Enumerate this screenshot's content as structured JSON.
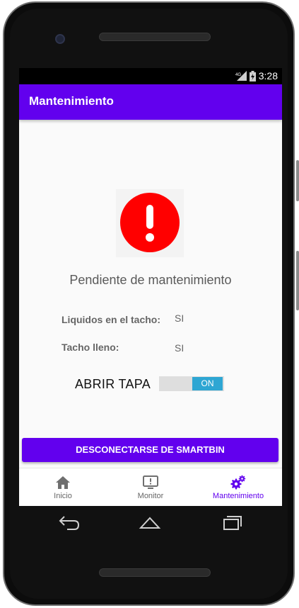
{
  "status_bar": {
    "network": "4G",
    "time": "3:28"
  },
  "app_bar": {
    "title": "Mantenimiento"
  },
  "alert": {
    "icon": "exclamation-icon",
    "color": "#ff0000"
  },
  "status_message": "Pendiente de mantenimiento",
  "details": [
    {
      "label": "Liquidos en el tacho:",
      "value": "SI"
    },
    {
      "label": "Tacho lleno:",
      "value": "SI"
    }
  ],
  "lid_toggle": {
    "label": "ABRIR TAPA",
    "state": "ON"
  },
  "disconnect_button": {
    "label": "DESCONECTARSE DE SMARTBIN"
  },
  "bottom_nav": {
    "items": [
      {
        "label": "Inicio",
        "icon": "home-icon"
      },
      {
        "label": "Monitor",
        "icon": "monitor-icon"
      },
      {
        "label": "Mantenimiento",
        "icon": "gears-icon",
        "active": true
      }
    ]
  },
  "colors": {
    "primary": "#6200ee",
    "toggle_on": "#2ea6d3",
    "alert": "#ff0000"
  }
}
